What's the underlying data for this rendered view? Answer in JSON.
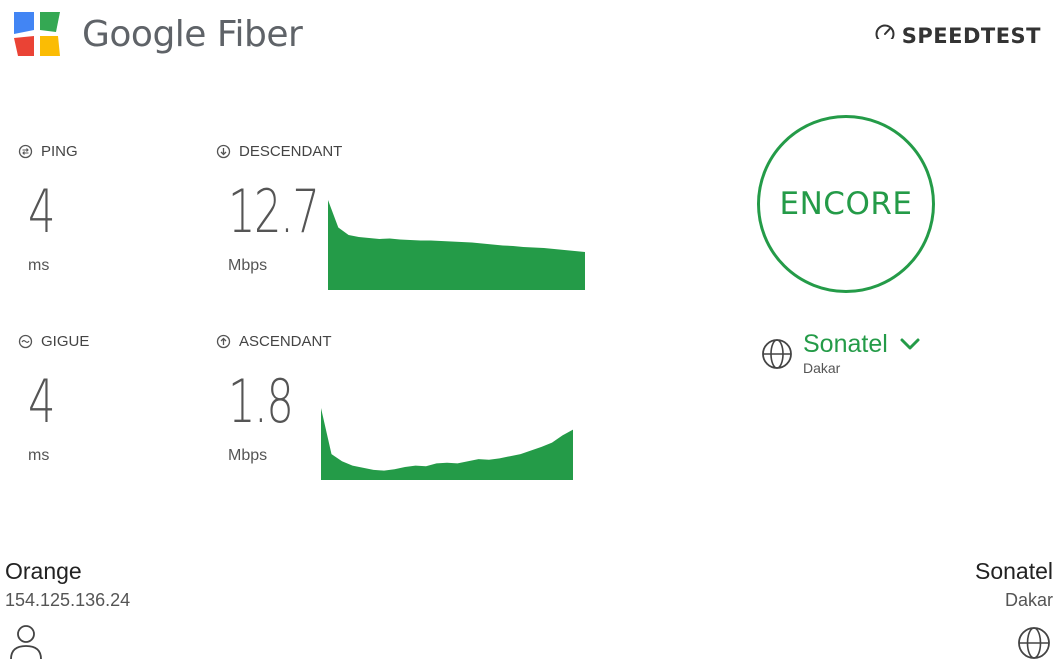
{
  "header": {
    "brand_text": "Google Fiber",
    "speedtest_label": "SPEEDTEST",
    "logo_colors": [
      "#4285f4",
      "#34a853",
      "#fbbc04",
      "#ea4335"
    ]
  },
  "metrics": {
    "ping": {
      "label": "PING",
      "value": "4",
      "unit": "ms",
      "icon": "ping-icon"
    },
    "jitter": {
      "label": "GIGUE",
      "value": "4",
      "unit": "ms",
      "icon": "jitter-icon"
    },
    "download": {
      "label": "DESCENDANT",
      "value": "12.7",
      "unit": "Mbps",
      "icon": "download-arrow-icon",
      "graph_samples": [
        18,
        12.5,
        11,
        10.6,
        10.4,
        10.2,
        10.3,
        10.1,
        10.0,
        9.9,
        9.9,
        9.8,
        9.7,
        9.6,
        9.5,
        9.3,
        9.1,
        8.9,
        8.8,
        8.6,
        8.5,
        8.4,
        8.2,
        8.0,
        7.8,
        7.6
      ]
    },
    "upload": {
      "label": "ASCENDANT",
      "value": "1.8",
      "unit": "Mbps",
      "icon": "upload-arrow-icon",
      "graph_samples": [
        10,
        3.6,
        2.6,
        2.0,
        1.7,
        1.4,
        1.3,
        1.5,
        1.8,
        2.0,
        1.9,
        2.3,
        2.4,
        2.3,
        2.6,
        2.9,
        2.8,
        3.0,
        3.3,
        3.6,
        4.1,
        4.6,
        5.2,
        6.2,
        7.0
      ]
    },
    "graph_color": "#249b48"
  },
  "actions": {
    "encore_label": "ENCORE",
    "accent_color": "#249b48"
  },
  "server": {
    "name": "Sonatel",
    "city": "Dakar",
    "icon": "globe-icon",
    "dropdown_icon": "chevron-down-icon"
  },
  "footer": {
    "isp_name": "Orange",
    "isp_ip": "154.125.136.24",
    "user_icon": "user-icon",
    "host_name": "Sonatel",
    "host_city": "Dakar",
    "host_icon": "globe-icon"
  }
}
